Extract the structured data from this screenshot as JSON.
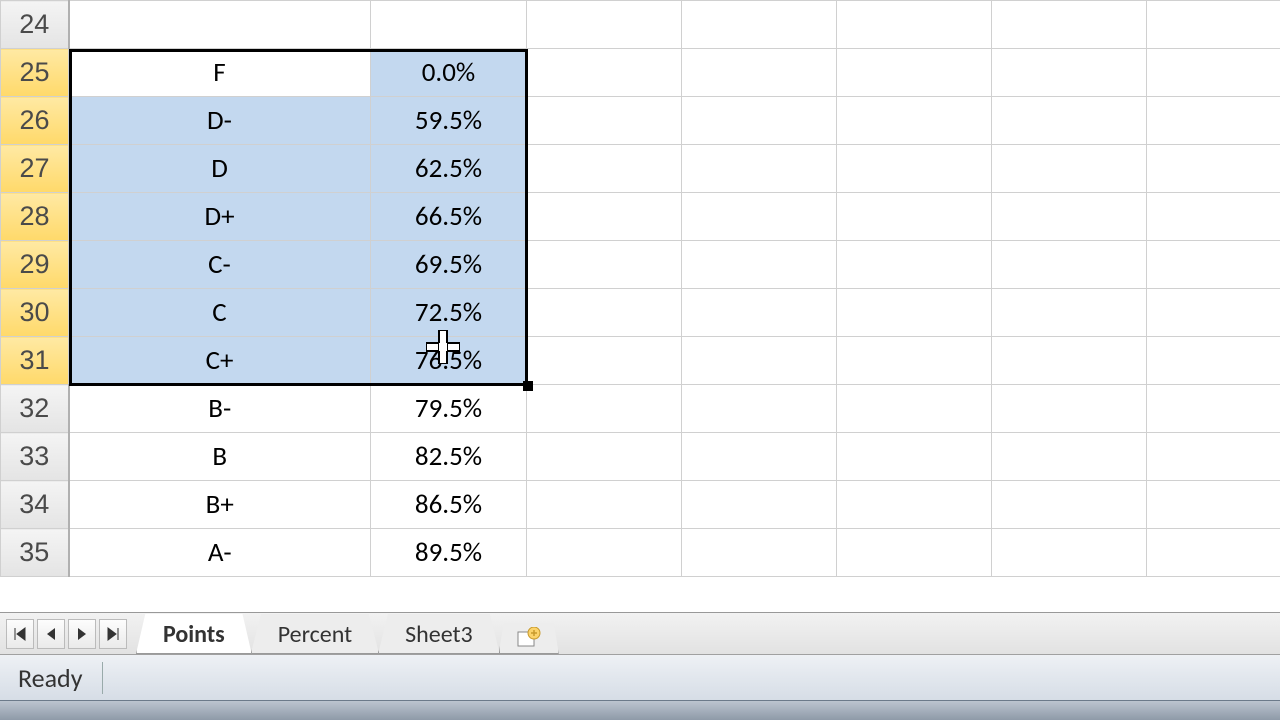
{
  "rows": [
    {
      "num": "24",
      "grade": "",
      "pct": "",
      "selected": false,
      "active": false,
      "hdrSel": false
    },
    {
      "num": "25",
      "grade": "F",
      "pct": "0.0%",
      "selected": true,
      "active": true,
      "hdrSel": true
    },
    {
      "num": "26",
      "grade": "D-",
      "pct": "59.5%",
      "selected": true,
      "active": false,
      "hdrSel": true
    },
    {
      "num": "27",
      "grade": "D",
      "pct": "62.5%",
      "selected": true,
      "active": false,
      "hdrSel": true
    },
    {
      "num": "28",
      "grade": "D+",
      "pct": "66.5%",
      "selected": true,
      "active": false,
      "hdrSel": true
    },
    {
      "num": "29",
      "grade": "C-",
      "pct": "69.5%",
      "selected": true,
      "active": false,
      "hdrSel": true
    },
    {
      "num": "30",
      "grade": "C",
      "pct": "72.5%",
      "selected": true,
      "active": false,
      "hdrSel": true
    },
    {
      "num": "31",
      "grade": "C+",
      "pct": "76.5%",
      "selected": true,
      "active": false,
      "hdrSel": true
    },
    {
      "num": "32",
      "grade": "B-",
      "pct": "79.5%",
      "selected": false,
      "active": false,
      "hdrSel": false
    },
    {
      "num": "33",
      "grade": "B",
      "pct": "82.5%",
      "selected": false,
      "active": false,
      "hdrSel": false
    },
    {
      "num": "34",
      "grade": "B+",
      "pct": "86.5%",
      "selected": false,
      "active": false,
      "hdrSel": false
    },
    {
      "num": "35",
      "grade": "A-",
      "pct": "89.5%",
      "selected": false,
      "active": false,
      "hdrSel": false
    }
  ],
  "extra_cols": 5,
  "tabs": {
    "items": [
      {
        "label": "Points",
        "active": true
      },
      {
        "label": "Percent",
        "active": false
      },
      {
        "label": "Sheet3",
        "active": false
      }
    ]
  },
  "status": {
    "text": "Ready"
  }
}
